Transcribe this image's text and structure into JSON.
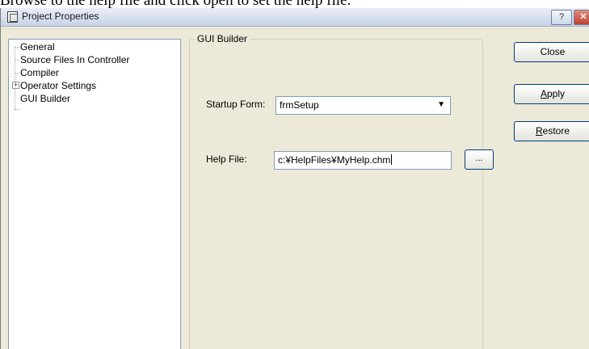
{
  "caption": "Browse to the help file and click open to set the help file.",
  "window": {
    "title": "Project Properties",
    "help_glyph": "?",
    "close_glyph": "✕",
    "title_icon": "properties-window-icon"
  },
  "tree": {
    "items": [
      {
        "label": "General"
      },
      {
        "label": "Source Files In Controller"
      },
      {
        "label": "Compiler"
      },
      {
        "label": "Operator Settings"
      },
      {
        "label": "GUI Builder"
      }
    ],
    "expander_glyph": "+"
  },
  "group": {
    "title": "GUI Builder",
    "startup_form": {
      "label": "Startup Form:",
      "value": "frmSetup",
      "arrow": "▼"
    },
    "help_file": {
      "label": "Help File:",
      "value": "c:¥HelpFiles¥MyHelp.chm"
    },
    "browse_label": "..."
  },
  "buttons": {
    "close": "Close",
    "apply_mnemonic": "A",
    "apply_rest": "pply",
    "restore_mnemonic": "R",
    "restore_rest": "estore"
  }
}
